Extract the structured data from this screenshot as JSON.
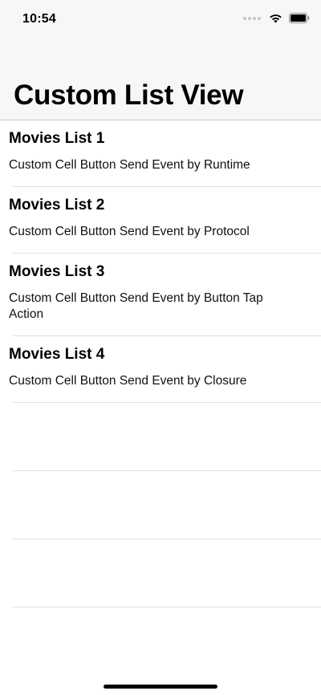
{
  "status_bar": {
    "time": "10:54",
    "icons": [
      "signal-dots-icon",
      "wifi-icon",
      "battery-icon"
    ]
  },
  "nav": {
    "title": "Custom List View"
  },
  "list": {
    "items": [
      {
        "title": "Movies List 1",
        "subtitle": "Custom Cell Button Send Event by Runtime"
      },
      {
        "title": "Movies List 2",
        "subtitle": "Custom Cell Button Send Event by Protocol"
      },
      {
        "title": "Movies List 3",
        "subtitle": "Custom Cell Button Send Event by Button Tap Action"
      },
      {
        "title": "Movies List 4",
        "subtitle": "Custom Cell Button Send Event by Closure"
      }
    ]
  },
  "colors": {
    "bar_background": "#f7f7f7",
    "separator": "#e0e0e0",
    "text": "#000000"
  }
}
